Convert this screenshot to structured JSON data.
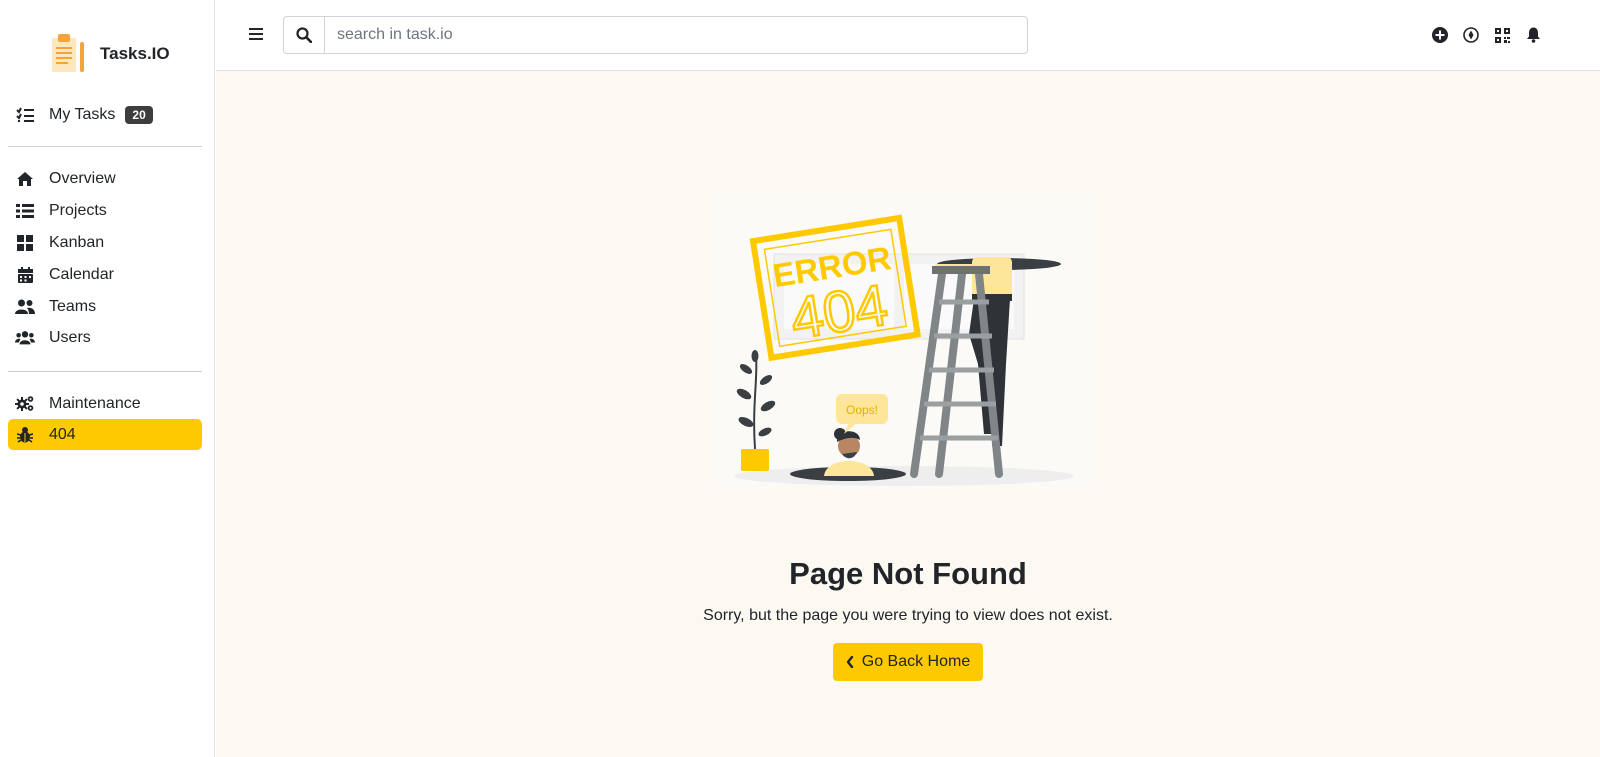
{
  "brand": {
    "name": "Tasks.IO"
  },
  "sidebar": {
    "my_tasks": {
      "label": "My Tasks",
      "count": "20",
      "icon": "checklist-icon"
    },
    "main_items": [
      {
        "label": "Overview",
        "icon": "home-icon"
      },
      {
        "label": "Projects",
        "icon": "list-icon"
      },
      {
        "label": "Kanban",
        "icon": "grid-icon"
      },
      {
        "label": "Calendar",
        "icon": "calendar-icon"
      },
      {
        "label": "Teams",
        "icon": "users-icon"
      },
      {
        "label": "Users",
        "icon": "user-group-icon"
      }
    ],
    "extra_items": [
      {
        "label": "Maintenance",
        "icon": "gears-icon"
      },
      {
        "label": "404",
        "icon": "bug-icon",
        "active": true
      }
    ]
  },
  "topbar": {
    "search_placeholder": "search in task.io",
    "icons": [
      "plus-circle-icon",
      "compass-icon",
      "qrcode-icon",
      "bell-icon"
    ]
  },
  "error": {
    "illustration_stamp_top": "ERROR",
    "illustration_stamp_code": "404",
    "illustration_bubble": "Oops!",
    "title": "Page Not Found",
    "message": "Sorry, but the page you were trying to view does not exist.",
    "button_label": "Go Back Home"
  },
  "colors": {
    "accent": "#ffc900",
    "main_bg": "#fcf9f3",
    "text": "#212529"
  }
}
